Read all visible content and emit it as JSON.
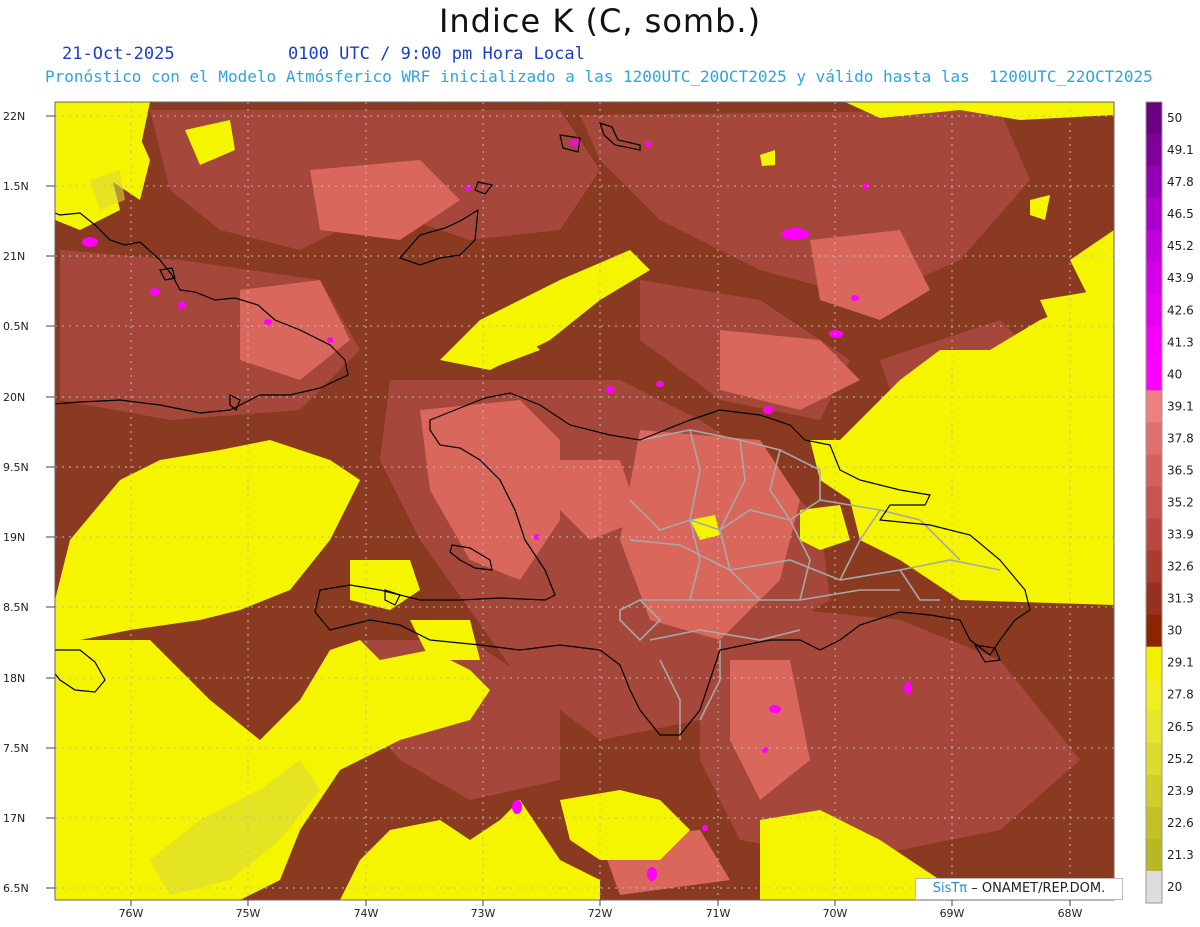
{
  "title": "Indice K (C, somb.)",
  "date": "21-Oct-2025",
  "time": "0100 UTC / 9:00 pm Hora Local",
  "forecast": "Pronóstico con el Modelo Atmósferico WRF inicializado a las 1200UTC_20OCT2025 y válido hasta las  1200UTC_22OCT2025",
  "credit": {
    "brand": "SisT",
    "pi": "π",
    "org": "– ONAMET/REP.DOM."
  },
  "lat_labels": [
    "22N",
    "1.5N",
    "21N",
    "0.5N",
    "20N",
    "9.5N",
    "19N",
    "8.5N",
    "18N",
    "7.5N",
    "17N",
    "6.5N"
  ],
  "lon_labels": [
    "76W",
    "75W",
    "74W",
    "73W",
    "72W",
    "71W",
    "70W",
    "69W",
    "68W"
  ],
  "colorbar": {
    "levels": [
      "50",
      "49.1",
      "47.8",
      "46.5",
      "45.2",
      "43.9",
      "42.6",
      "41.3",
      "40",
      "39.1",
      "37.8",
      "36.5",
      "35.2",
      "33.9",
      "32.6",
      "31.3",
      "30",
      "29.1",
      "27.8",
      "26.5",
      "25.2",
      "23.9",
      "22.6",
      "21.3",
      "20"
    ],
    "colors": [
      "#6a0080",
      "#7d0099",
      "#9400b3",
      "#aa00cc",
      "#c200dd",
      "#d400ea",
      "#e600f2",
      "#f500f8",
      "#ff00ff",
      "#f08080",
      "#e07070",
      "#d66060",
      "#c85450",
      "#b94840",
      "#a83c30",
      "#963020",
      "#8b2500",
      "#f5f000",
      "#f0ee20",
      "#e6e630",
      "#dcdc30",
      "#cfcf2c",
      "#c2c228",
      "#b8b824",
      "#dddddd"
    ]
  },
  "colors": {
    "yellow": "#f5f500",
    "brown": "#8b3a22",
    "rust": "#a5473a",
    "pink": "#d9675c",
    "magenta": "#ff00ff"
  }
}
